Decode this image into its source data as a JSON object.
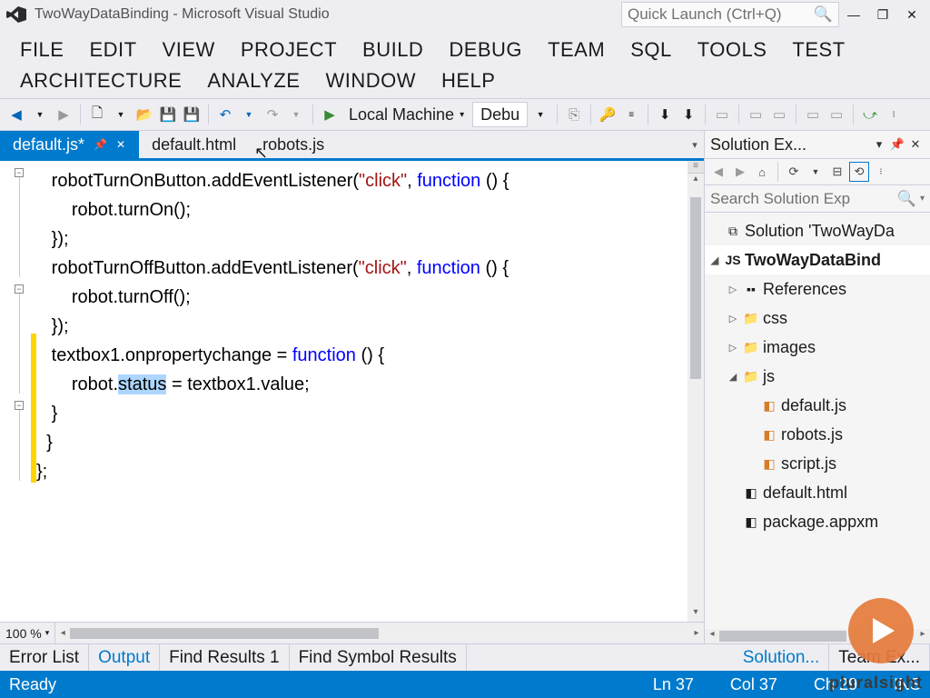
{
  "title": "TwoWayDataBinding - Microsoft Visual Studio",
  "quicklaunch_placeholder": "Quick Launch (Ctrl+Q)",
  "menus": [
    "FILE",
    "EDIT",
    "VIEW",
    "PROJECT",
    "BUILD",
    "DEBUG",
    "TEAM",
    "SQL",
    "TOOLS",
    "TEST",
    "ARCHITECTURE",
    "ANALYZE",
    "WINDOW",
    "HELP"
  ],
  "toolbar": {
    "start_target": "Local Machine",
    "config": "Debu"
  },
  "tabs": [
    {
      "label": "default.js*",
      "active": true
    },
    {
      "label": "default.html",
      "active": false
    },
    {
      "label": "robots.js",
      "active": false
    }
  ],
  "code_tokens": [
    [
      {
        "t": "   robotTurnOnButton.addEventListener("
      },
      {
        "t": "\"click\"",
        "c": "str"
      },
      {
        "t": ", "
      },
      {
        "t": "function",
        "c": "kw"
      },
      {
        "t": " () {"
      }
    ],
    [
      {
        "t": "       robot.turnOn();"
      }
    ],
    [
      {
        "t": "   });"
      }
    ],
    [
      {
        "t": ""
      }
    ],
    [
      {
        "t": "   robotTurnOffButton.addEventListener("
      },
      {
        "t": "\"click\"",
        "c": "str"
      },
      {
        "t": ", "
      },
      {
        "t": "function",
        "c": "kw"
      },
      {
        "t": " () {"
      }
    ],
    [
      {
        "t": "       robot.turnOff();"
      }
    ],
    [
      {
        "t": "   });"
      }
    ],
    [
      {
        "t": ""
      }
    ],
    [
      {
        "t": "   textbox1.onpropertychange = "
      },
      {
        "t": "function",
        "c": "kw"
      },
      {
        "t": " () {"
      }
    ],
    [
      {
        "t": "       robot."
      },
      {
        "t": "status",
        "c": "sel"
      },
      {
        "t": " = textbox1.value;"
      }
    ],
    [
      {
        "t": "   }"
      }
    ],
    [
      {
        "t": "  }"
      }
    ],
    [
      {
        "t": "};"
      }
    ]
  ],
  "zoom": "100 %",
  "solution_explorer": {
    "title": "Solution Ex...",
    "search_placeholder": "Search Solution Exp",
    "nodes": [
      {
        "indent": 0,
        "tw": "",
        "icon": "⧉",
        "label": "Solution 'TwoWayDa"
      },
      {
        "indent": 0,
        "tw": "◢",
        "icon": "JS",
        "label": "TwoWayDataBind",
        "bold": true,
        "sel": true
      },
      {
        "indent": 1,
        "tw": "▷",
        "icon": "▪▪",
        "label": "References"
      },
      {
        "indent": 1,
        "tw": "▷",
        "icon": "📁",
        "label": "css"
      },
      {
        "indent": 1,
        "tw": "▷",
        "icon": "📁",
        "label": "images"
      },
      {
        "indent": 1,
        "tw": "◢",
        "icon": "📁",
        "label": "js"
      },
      {
        "indent": 2,
        "tw": "",
        "icon": "◧",
        "label": "default.js",
        "orange": true
      },
      {
        "indent": 2,
        "tw": "",
        "icon": "◧",
        "label": "robots.js",
        "orange": true
      },
      {
        "indent": 2,
        "tw": "",
        "icon": "◧",
        "label": "script.js",
        "orange": true
      },
      {
        "indent": 1,
        "tw": "",
        "icon": "◧",
        "label": "default.html"
      },
      {
        "indent": 1,
        "tw": "",
        "icon": "◧",
        "label": "package.appxm"
      }
    ]
  },
  "bottom_tabs_left": [
    "Error List",
    "Output",
    "Find Results 1",
    "Find Symbol Results"
  ],
  "bottom_tabs_right": [
    "Solution...",
    "Team Ex..."
  ],
  "bottom_active": "Output",
  "bottom_right_active": "Solution...",
  "status": {
    "ready": "Ready",
    "ln": "Ln 37",
    "col": "Col 37",
    "ch": "Ch 29",
    "ins": "INS"
  },
  "brand": "pluralsight"
}
